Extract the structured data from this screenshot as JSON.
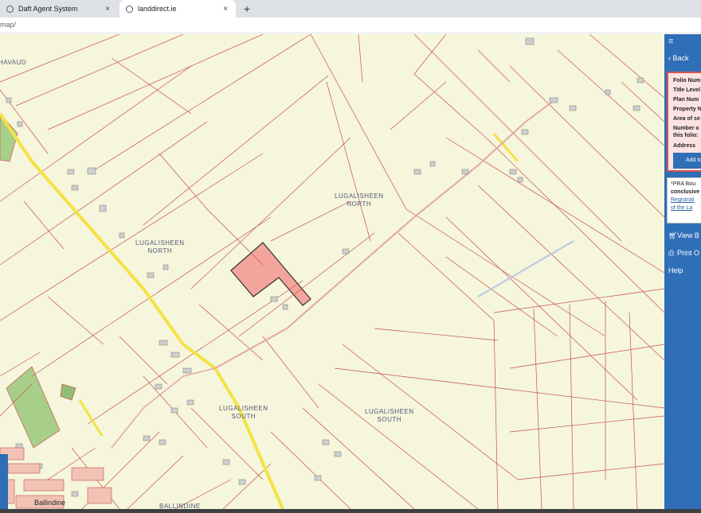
{
  "browser": {
    "tabs": [
      {
        "label": "Daft Agent System",
        "active": false
      },
      {
        "label": "landdirect.ie",
        "active": true
      }
    ],
    "new_tab": "+",
    "close_glyph": "×",
    "url": "map/"
  },
  "map": {
    "townland_labels": [
      {
        "line1": "HAVAUD",
        "line2": ""
      },
      {
        "line1": "LUGALISHEEN",
        "line2": "NORTH"
      },
      {
        "line1": "LUGALISHEEN",
        "line2": "NORTH"
      },
      {
        "line1": "LUGALISHEEN",
        "line2": "SOUTH"
      },
      {
        "line1": "LUGALISHEEN",
        "line2": "SOUTH"
      },
      {
        "line1": "BALLINDINE",
        "line2": ""
      }
    ],
    "place_name": "Ballindine",
    "colors": {
      "background": "#f5f6dc",
      "boundary": "#c8504b",
      "road": "#f4e244",
      "selected_parcel": "#f4a59b"
    }
  },
  "panel": {
    "menu_icon": "≡",
    "back_label": "Back",
    "info_rows": [
      "Folio Num",
      "Title Level",
      "Plan Num",
      "Property N",
      "Area of se",
      "Number o",
      "this folio:",
      "Address"
    ],
    "add_button": "Add to",
    "pra": {
      "line1": "*PRA Bou",
      "line2": "conclusive",
      "link1": "Registrati",
      "link2": "of the La"
    },
    "nav": [
      {
        "icon": "cart-icon",
        "label": "View B"
      },
      {
        "icon": "print-icon",
        "label": "Print O"
      },
      {
        "icon": "",
        "label": "Help"
      }
    ],
    "colors": {
      "panel": "#2f6fb7",
      "card_border": "#d9534f"
    }
  }
}
